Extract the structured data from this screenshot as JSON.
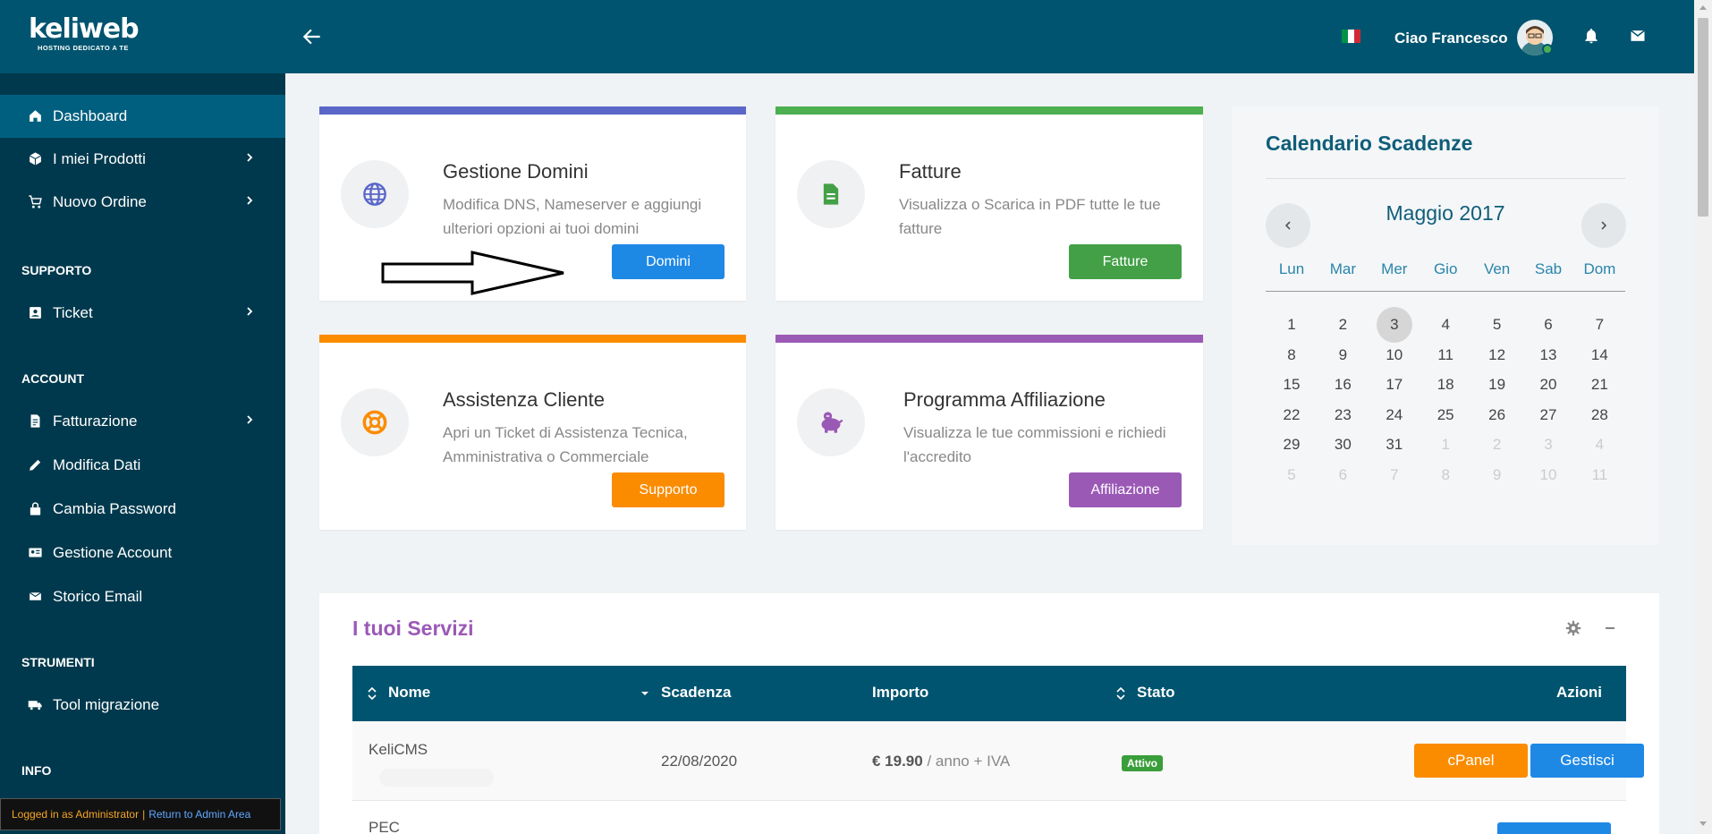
{
  "header": {
    "logo_main": "keliweb",
    "logo_sub": "HOSTING DEDICATO A TE",
    "back_icon": "arrow-left-icon",
    "language_flag": {
      "name": "italy-flag",
      "colors": [
        "#009246",
        "#ffffff",
        "#ce2b37"
      ]
    },
    "greeting": "Ciao Francesco",
    "notifications_icon": "bell-icon",
    "messages_icon": "envelope-icon"
  },
  "sidebar": {
    "items": [
      {
        "label": "Dashboard",
        "icon": "home-icon",
        "active": true
      },
      {
        "label": "I miei Prodotti",
        "icon": "box-icon",
        "has_submenu": true
      },
      {
        "label": "Nuovo Ordine",
        "icon": "cart-icon",
        "has_submenu": true
      }
    ],
    "sections": [
      {
        "title": "SUPPORTO",
        "items": [
          {
            "label": "Ticket",
            "icon": "ticket-icon",
            "has_submenu": true
          }
        ]
      },
      {
        "title": "ACCOUNT",
        "items": [
          {
            "label": "Fatturazione",
            "icon": "document-icon",
            "has_submenu": true
          },
          {
            "label": "Modifica Dati",
            "icon": "pencil-icon"
          },
          {
            "label": "Cambia Password",
            "icon": "lock-icon"
          },
          {
            "label": "Gestione Account",
            "icon": "id-card-icon"
          },
          {
            "label": "Storico Email",
            "icon": "mail-icon"
          }
        ]
      },
      {
        "title": "STRUMENTI",
        "items": [
          {
            "label": "Tool migrazione",
            "icon": "truck-icon"
          }
        ]
      },
      {
        "title": "INFO",
        "items": []
      }
    ]
  },
  "admin_bar": {
    "logged_in": "Logged in as Administrator",
    "separator": "|",
    "return_link": "Return to Admin Area"
  },
  "cards": [
    {
      "title": "Gestione Domini",
      "description": "Modifica DNS, Nameserver e aggiungi ulteriori opzioni ai tuoi domini",
      "button": "Domini",
      "icon": "globe-icon",
      "accent": "#5a67c8",
      "button_color": "#1e88e5"
    },
    {
      "title": "Fatture",
      "description": "Visualizza o Scarica in PDF tutte le tue fatture",
      "button": "Fatture",
      "icon": "file-icon",
      "accent": "#4caf50",
      "button_color": "#43a047"
    },
    {
      "title": "Assistenza Cliente",
      "description": "Apri un Ticket di Assistenza Tecnica, Amministrativa o Commerciale",
      "button": "Supporto",
      "icon": "lifebuoy-icon",
      "accent": "#fb8c00",
      "button_color": "#fb8c00"
    },
    {
      "title": "Programma Affiliazione",
      "description": "Visualizza le tue commissioni e richiedi l'accredito",
      "button": "Affiliazione",
      "icon": "piggy-bank-icon",
      "accent": "#9b59b6",
      "button_color": "#9b59b6"
    }
  ],
  "calendar": {
    "title": "Calendario Scadenze",
    "month": "Maggio 2017",
    "prev_icon": "chevron-left-icon",
    "next_icon": "chevron-right-icon",
    "weekdays": [
      "Lun",
      "Mar",
      "Mer",
      "Gio",
      "Ven",
      "Sab",
      "Dom"
    ],
    "weeks": [
      [
        "1",
        "2",
        "3",
        "4",
        "5",
        "6",
        "7"
      ],
      [
        "8",
        "9",
        "10",
        "11",
        "12",
        "13",
        "14"
      ],
      [
        "15",
        "16",
        "17",
        "18",
        "19",
        "20",
        "21"
      ],
      [
        "22",
        "23",
        "24",
        "25",
        "26",
        "27",
        "28"
      ],
      [
        "29",
        "30",
        "31",
        "1",
        "2",
        "3",
        "4"
      ],
      [
        "5",
        "6",
        "7",
        "8",
        "9",
        "10",
        "11"
      ]
    ],
    "today": "3"
  },
  "services": {
    "title": "I tuoi Servizi",
    "settings_icon": "gear-icon",
    "minimize_icon": "minus-icon",
    "columns": [
      "Nome",
      "Scadenza",
      "Importo",
      "Stato",
      "Azioni"
    ],
    "rows": [
      {
        "name": "KeliCMS",
        "expiry": "22/08/2020",
        "price": "€ 19.90",
        "period": " / anno + IVA",
        "status": "Attivo",
        "actions": [
          "cPanel",
          "Gestisci"
        ]
      },
      {
        "name": "PEC",
        "expiry": "",
        "price": "",
        "period": "",
        "status": "",
        "actions": []
      }
    ]
  }
}
